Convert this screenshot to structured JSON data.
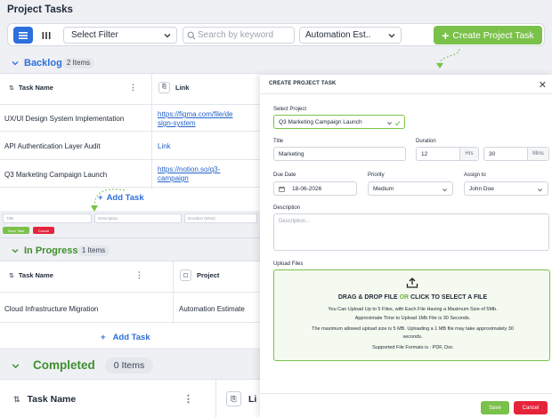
{
  "page": {
    "title": "Project Tasks"
  },
  "toolbar": {
    "filter_value": "Select Filter",
    "search_placeholder": "Search by keyword",
    "estimate_value": "Automation Est..",
    "create_label": "Create Project Task"
  },
  "backlog": {
    "title": "Backlog",
    "count": "2 Items",
    "columns": [
      "Task Name",
      "Link"
    ],
    "rows": [
      {
        "task": "UX/UI Design System Implementation",
        "link_line1": "https://figma.com/file/de",
        "link_line2": "sign-system"
      },
      {
        "task": "API Authentication Layer Audit",
        "link_line1": "Link",
        "link_line2": ""
      },
      {
        "task": "Q3 Marketing Campaign Launch",
        "link_line1": "https://notion.so/q3-",
        "link_line2": "campaign"
      }
    ],
    "add_task": "Add Task",
    "inline_form": {
      "title_placeholder": "Title",
      "description_placeholder": "Description",
      "duration_placeholder": "Duration (Mins)",
      "save": "Save Task",
      "cancel": "Cancel"
    }
  },
  "in_progress": {
    "title": "In Progress",
    "count": "1 Items",
    "columns": [
      "Task Name",
      "Project"
    ],
    "rows": [
      {
        "task": "Cloud Infrastructure Migration",
        "project": "Automation Estimate"
      }
    ],
    "add_task": "Add Task"
  },
  "completed": {
    "title": "Completed",
    "count": "0 Items",
    "columns": [
      "Task Name",
      "Li"
    ]
  },
  "modal": {
    "title": "CREATE PROJECT TASK",
    "select_project_label": "Select Project",
    "select_project_value": "Q3 Marketing Campaign Launch",
    "title_label": "Title",
    "title_value": "Marketing",
    "duration_label": "Duration",
    "hours_value": "12",
    "hours_unit": "Hrs",
    "mins_value": "30",
    "mins_unit": "Mins",
    "due_label": "Due Date",
    "due_value": "18-06-2026",
    "priority_label": "Priority",
    "priority_value": "Medium",
    "assign_label": "Assign to",
    "assign_value": "John Doe",
    "description_label": "Description",
    "description_placeholder": "Description...",
    "upload_label": "Upload Files",
    "dz_title_a": "DRAG & DROP FILE",
    "dz_or": "OR",
    "dz_title_b": "CLICK TO SELECT A FILE",
    "dz_line1": "You Can Upload Up to 5 Files, with Each File Having a Maximum Size of 5Mb.",
    "dz_line2": "Approximate Time to Upload 1Mb File is 30 Seconds.",
    "dz_line3": "The maximum allowed upload size is 5 MB. Uploading a 1 MB file may take approximately 30",
    "dz_line4": "seconds.",
    "dz_line5": "Supported File Formats is : PDF, Doc",
    "save": "Save",
    "cancel": "Cancel"
  },
  "colors": {
    "accent_blue": "#2d6fdb",
    "accent_green": "#7ac14a",
    "danger_red": "#e5243b"
  }
}
